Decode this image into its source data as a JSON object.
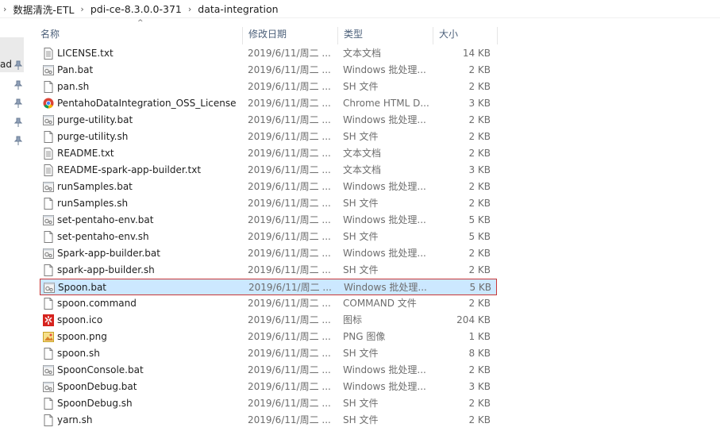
{
  "breadcrumb": {
    "items": [
      "数据清洗-ETL",
      "pdi-ce-8.3.0.0-371",
      "data-integration"
    ]
  },
  "nav": {
    "partial_label": "ad"
  },
  "columns": {
    "name": "名称",
    "date": "修改日期",
    "type": "类型",
    "size": "大小"
  },
  "files": [
    {
      "name": "LICENSE.txt",
      "date": "2019/6/11/周二 ...",
      "type": "文本文档",
      "size": "14 KB",
      "icon": "text-file-icon"
    },
    {
      "name": "Pan.bat",
      "date": "2019/6/11/周二 ...",
      "type": "Windows 批处理...",
      "size": "2 KB",
      "icon": "batch-file-icon"
    },
    {
      "name": "pan.sh",
      "date": "2019/6/11/周二 ...",
      "type": "SH 文件",
      "size": "2 KB",
      "icon": "generic-file-icon"
    },
    {
      "name": "PentahoDataIntegration_OSS_License...",
      "date": "2019/6/11/周二 ...",
      "type": "Chrome HTML D...",
      "size": "3 KB",
      "icon": "chrome-html-icon"
    },
    {
      "name": "purge-utility.bat",
      "date": "2019/6/11/周二 ...",
      "type": "Windows 批处理...",
      "size": "2 KB",
      "icon": "batch-file-icon"
    },
    {
      "name": "purge-utility.sh",
      "date": "2019/6/11/周二 ...",
      "type": "SH 文件",
      "size": "2 KB",
      "icon": "generic-file-icon"
    },
    {
      "name": "README.txt",
      "date": "2019/6/11/周二 ...",
      "type": "文本文档",
      "size": "2 KB",
      "icon": "text-file-icon"
    },
    {
      "name": "README-spark-app-builder.txt",
      "date": "2019/6/11/周二 ...",
      "type": "文本文档",
      "size": "3 KB",
      "icon": "text-file-icon"
    },
    {
      "name": "runSamples.bat",
      "date": "2019/6/11/周二 ...",
      "type": "Windows 批处理...",
      "size": "2 KB",
      "icon": "batch-file-icon"
    },
    {
      "name": "runSamples.sh",
      "date": "2019/6/11/周二 ...",
      "type": "SH 文件",
      "size": "2 KB",
      "icon": "generic-file-icon"
    },
    {
      "name": "set-pentaho-env.bat",
      "date": "2019/6/11/周二 ...",
      "type": "Windows 批处理...",
      "size": "5 KB",
      "icon": "batch-file-icon"
    },
    {
      "name": "set-pentaho-env.sh",
      "date": "2019/6/11/周二 ...",
      "type": "SH 文件",
      "size": "5 KB",
      "icon": "generic-file-icon"
    },
    {
      "name": "Spark-app-builder.bat",
      "date": "2019/6/11/周二 ...",
      "type": "Windows 批处理...",
      "size": "2 KB",
      "icon": "batch-file-icon"
    },
    {
      "name": "spark-app-builder.sh",
      "date": "2019/6/11/周二 ...",
      "type": "SH 文件",
      "size": "2 KB",
      "icon": "generic-file-icon"
    },
    {
      "name": "Spoon.bat",
      "date": "2019/6/11/周二 ...",
      "type": "Windows 批处理...",
      "size": "5 KB",
      "icon": "batch-file-icon",
      "selected": true
    },
    {
      "name": "spoon.command",
      "date": "2019/6/11/周二 ...",
      "type": "COMMAND 文件",
      "size": "2 KB",
      "icon": "generic-file-icon"
    },
    {
      "name": "spoon.ico",
      "date": "2019/6/11/周二 ...",
      "type": "图标",
      "size": "204 KB",
      "icon": "ico-image-icon"
    },
    {
      "name": "spoon.png",
      "date": "2019/6/11/周二 ...",
      "type": "PNG 图像",
      "size": "1 KB",
      "icon": "png-image-icon"
    },
    {
      "name": "spoon.sh",
      "date": "2019/6/11/周二 ...",
      "type": "SH 文件",
      "size": "8 KB",
      "icon": "generic-file-icon"
    },
    {
      "name": "SpoonConsole.bat",
      "date": "2019/6/11/周二 ...",
      "type": "Windows 批处理...",
      "size": "2 KB",
      "icon": "batch-file-icon"
    },
    {
      "name": "SpoonDebug.bat",
      "date": "2019/6/11/周二 ...",
      "type": "Windows 批处理...",
      "size": "3 KB",
      "icon": "batch-file-icon"
    },
    {
      "name": "SpoonDebug.sh",
      "date": "2019/6/11/周二 ...",
      "type": "SH 文件",
      "size": "2 KB",
      "icon": "generic-file-icon"
    },
    {
      "name": "yarn.sh",
      "date": "2019/6/11/周二 ...",
      "type": "SH 文件",
      "size": "2 KB",
      "icon": "generic-file-icon"
    }
  ],
  "colors": {
    "selection_bg": "#cce8ff",
    "selection_border": "#c83838",
    "header_text": "#4c607a",
    "secondary_text": "#6d6d6d"
  }
}
